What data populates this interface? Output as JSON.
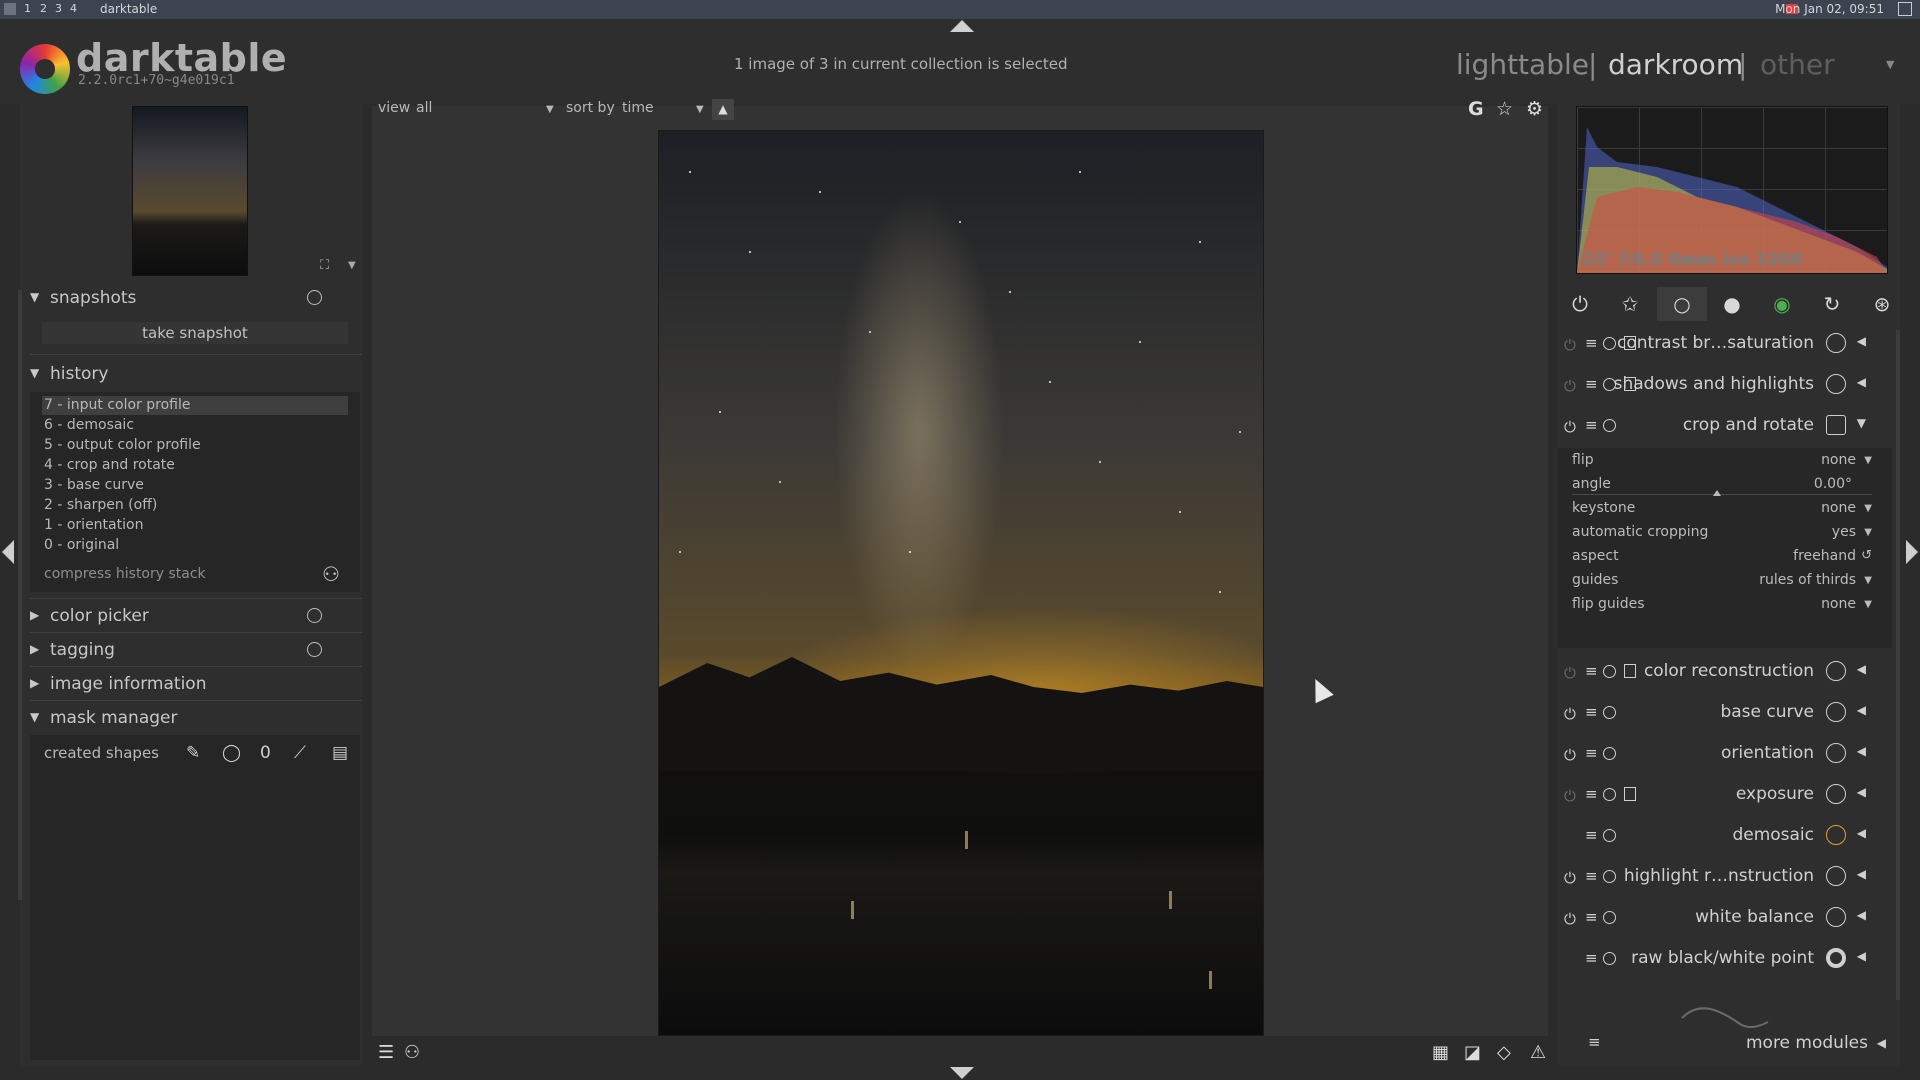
{
  "os_bar": {
    "workspaces": [
      "1",
      "2",
      "3",
      "4"
    ],
    "app_title": "darktable",
    "clock": "Mon Jan 02, 09:51"
  },
  "app": {
    "name": "darktable",
    "version": "2.2.0rc1+70~g4e019c1"
  },
  "header": {
    "selection_info": "1 image of 3 in current collection is selected",
    "views": {
      "lighttable": "lighttable",
      "separator": "|",
      "darkroom": "darkroom",
      "other": "other"
    }
  },
  "center_toolbar": {
    "view_label": "view",
    "view_value": "all",
    "sort_label": "sort by",
    "sort_value": "time"
  },
  "left_panel": {
    "snapshots": {
      "title": "snapshots",
      "take_snapshot": "take snapshot"
    },
    "history": {
      "title": "history",
      "items": [
        "7 - input color profile",
        "6 - demosaic",
        "5 - output color profile",
        "4 - crop and rotate",
        "3 - base curve",
        "2 - sharpen (off)",
        "1 - orientation",
        "0 - original"
      ],
      "compress": "compress history stack"
    },
    "color_picker": "color picker",
    "tagging": "tagging",
    "image_information": "image information",
    "mask_manager": {
      "title": "mask manager",
      "created_shapes": "created shapes"
    }
  },
  "right_panel": {
    "histogram_info": "20″ f/0.0 0mm iso 3200",
    "modules": [
      {
        "name": "contrast br…saturation"
      },
      {
        "name": "shadows and highlights"
      },
      {
        "name": "crop and rotate"
      },
      {
        "name": "color reconstruction"
      },
      {
        "name": "base curve"
      },
      {
        "name": "orientation"
      },
      {
        "name": "exposure"
      },
      {
        "name": "demosaic"
      },
      {
        "name": "highlight r…nstruction"
      },
      {
        "name": "white balance"
      },
      {
        "name": "raw black/white point"
      }
    ],
    "crop_params": {
      "flip": {
        "label": "flip",
        "value": "none"
      },
      "angle": {
        "label": "angle",
        "value": "0.00°"
      },
      "keystone": {
        "label": "keystone",
        "value": "none"
      },
      "auto_crop": {
        "label": "automatic cropping",
        "value": "yes"
      },
      "aspect": {
        "label": "aspect",
        "value": "freehand"
      },
      "guides": {
        "label": "guides",
        "value": "rules of thirds"
      },
      "flip_guides": {
        "label": "flip guides",
        "value": "none"
      }
    },
    "more_modules": "more modules"
  },
  "icons": {
    "power": "power-icon",
    "favorite": "star-icon",
    "basic": "circle-icon",
    "tone": "filled-circle-icon",
    "color": "color-wheel-icon",
    "correct": "refresh-icon",
    "effect": "aperture-icon"
  },
  "colors": {
    "background": "#2b2b2b",
    "panel": "#2e2e2e",
    "center": "#333333",
    "text": "#b8b8b8"
  }
}
